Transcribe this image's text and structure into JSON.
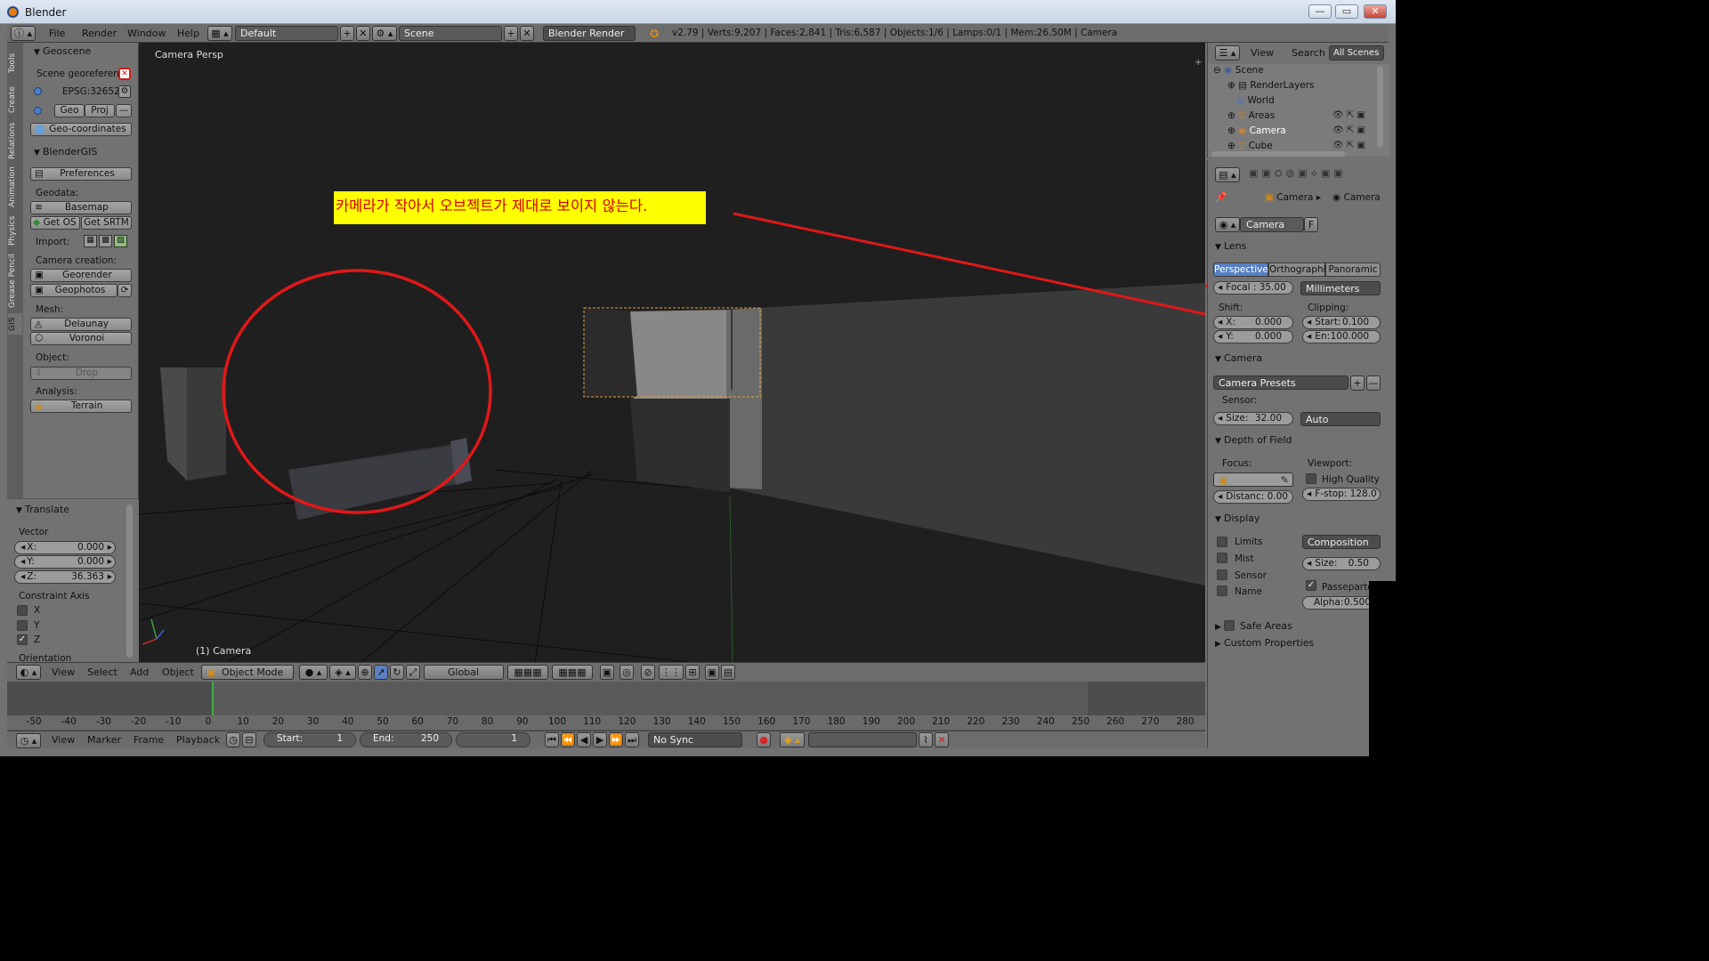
{
  "app": {
    "title": "Blender"
  },
  "window_controls": {
    "minimize": "—",
    "maximize": "▭",
    "close": "✕"
  },
  "topbar": {
    "menus": [
      "File",
      "Render",
      "Window",
      "Help"
    ],
    "layout": "Default",
    "scene": "Scene",
    "engine": "Blender Render",
    "stats": "v2.79 | Verts:9,207 | Faces:2,841 | Tris:6,587 | Objects:1/6 | Lamps:0/1 | Mem:26.50M | Camera"
  },
  "left_tabs": [
    "Tools",
    "Create",
    "Relations",
    "Animation",
    "Physics",
    "Grease Pencil",
    "GIS"
  ],
  "geoscene": {
    "title": "Geoscene",
    "georef_label": "Scene georeferen...",
    "crs": "EPSG:32652",
    "geo_btn": "Geo",
    "proj_btn": "Proj",
    "geocoords_btn": "Geo-coordinates"
  },
  "blendergis": {
    "title": "BlenderGIS",
    "preferences": "Preferences",
    "geodata_label": "Geodata:",
    "basemap": "Basemap",
    "get_os": "Get OS",
    "get_srtm": "Get SRTM",
    "import_label": "Import:",
    "camera_creation_label": "Camera creation:",
    "georender": "Georender",
    "geophotos": "Geophotos",
    "mesh_label": "Mesh:",
    "delaunay": "Delaunay",
    "voronoi": "Voronoi",
    "object_label": "Object:",
    "drop": "Drop",
    "analysis_label": "Analysis:",
    "terrain": "Terrain"
  },
  "translate": {
    "title": "Translate",
    "vector_label": "Vector",
    "x": "X:",
    "x_val": "0.000",
    "y": "Y:",
    "y_val": "0.000",
    "z": "Z:",
    "z_val": "36.363",
    "constraint_label": "Constraint Axis",
    "cx": "X",
    "cy": "Y",
    "cz": "Z",
    "orientation_label": "Orientation"
  },
  "viewport": {
    "label": "Camera Persp",
    "object_label": "(1) Camera",
    "annotation": "카메라가 작아서 오브젝트가 제대로 보이지 않는다.",
    "annotation_bg": "#ffff00",
    "annotation_color": "#d40000",
    "mark_color": "#e01818"
  },
  "vp_header": {
    "menus": [
      "View",
      "Select",
      "Add",
      "Object"
    ],
    "mode": "Object Mode",
    "orientation": "Global"
  },
  "ruler": {
    "ticks": [
      "-50",
      "-40",
      "-30",
      "-20",
      "-10",
      "0",
      "10",
      "20",
      "30",
      "40",
      "50",
      "60",
      "70",
      "80",
      "90",
      "100",
      "110",
      "120",
      "130",
      "140",
      "150",
      "160",
      "170",
      "180",
      "190",
      "200",
      "210",
      "220",
      "230",
      "240",
      "250",
      "260",
      "270",
      "280"
    ]
  },
  "timeline": {
    "menus": [
      "View",
      "Marker",
      "Frame",
      "Playback"
    ],
    "start_label": "Start:",
    "start_val": "1",
    "end_label": "End:",
    "end_val": "250",
    "current": "1",
    "sync": "No Sync"
  },
  "outliner": {
    "menus": [
      "View",
      "Search"
    ],
    "display": "All Scenes",
    "items": [
      "Scene",
      "RenderLayers",
      "World",
      "Areas",
      "Camera",
      "Cube"
    ]
  },
  "properties": {
    "breadcrumb": [
      "Camera",
      "Camera"
    ],
    "datablock": "Camera",
    "fake_user": "F",
    "lens": {
      "title": "Lens",
      "types": [
        "Perspective",
        "Orthographic",
        "Panoramic"
      ],
      "focal": "Focal : 35.00",
      "units": "Millimeters",
      "shift_label": "Shift:",
      "clipping_label": "Clipping:",
      "shift_x": "X:",
      "shift_x_val": "0.000",
      "shift_y": "Y:",
      "shift_y_val": "0.000",
      "clip_start": "Start:",
      "clip_start_val": "0.100",
      "clip_end": "En:",
      "clip_end_val": "100.000"
    },
    "camera": {
      "title": "Camera",
      "presets": "Camera Presets",
      "sensor_label": "Sensor:",
      "size_label": "Size:",
      "size_val": "32.00",
      "fit": "Auto"
    },
    "dof": {
      "title": "Depth of Field",
      "focus_label": "Focus:",
      "viewport_label": "Viewport:",
      "high_quality": "High Quality",
      "distance": "Distanc: 0.00",
      "fstop": "F-stop: 128.0"
    },
    "display": {
      "title": "Display",
      "limits": "Limits",
      "mist": "Mist",
      "sensor": "Sensor",
      "name": "Name",
      "composition": "Composition ...",
      "size": "Size:",
      "size_val": "0.50",
      "passepartout": "Passepartout",
      "alpha": "Alpha:",
      "alpha_val": "0.500"
    },
    "safe_areas": "Safe Areas",
    "custom_props": "Custom Properties"
  }
}
